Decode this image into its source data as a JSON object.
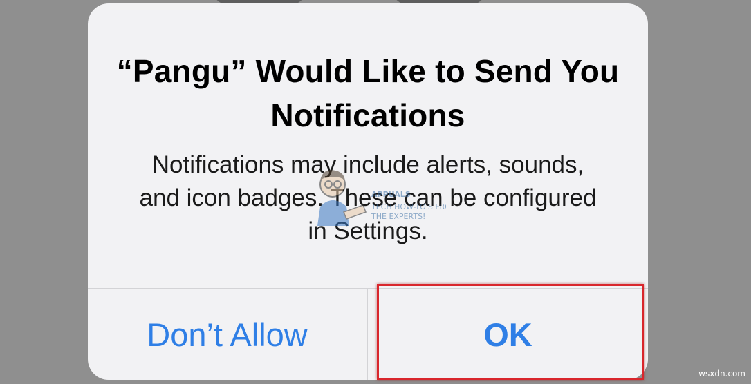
{
  "alert": {
    "title": "“Pangu” Would Like to Send You Notifications",
    "message": "Notifications may include alerts, sounds, and icon badges. These can be configured in Settings.",
    "buttons": {
      "cancel": "Don’t Allow",
      "ok": "OK"
    }
  },
  "watermark": {
    "brand": "APPUALS",
    "tagline_1": "TECH HOW-TO'S FROM",
    "tagline_2": "THE EXPERTS!"
  },
  "site_mark": "wsxdn.com",
  "colors": {
    "button_text": "#2f7fe6",
    "highlight": "#d9262c",
    "alert_bg": "#f2f2f4",
    "backdrop": "#8f8f8f"
  }
}
